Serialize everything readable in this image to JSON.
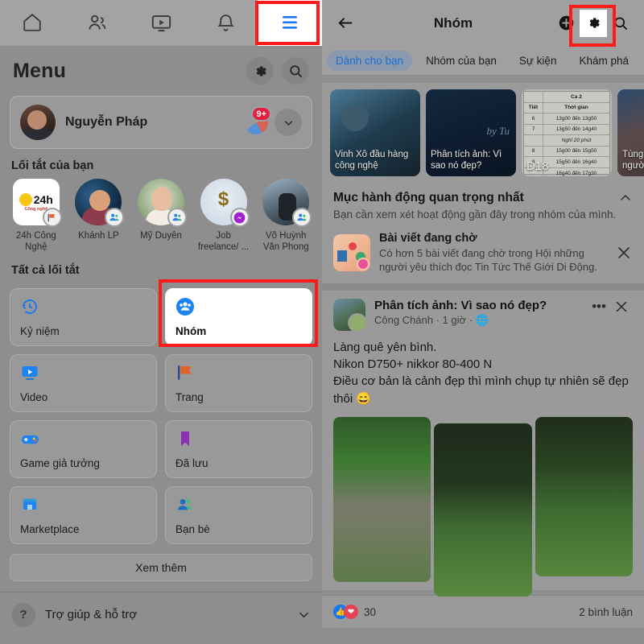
{
  "left": {
    "topnav": [
      {
        "name": "home",
        "icon": "home-icon"
      },
      {
        "name": "friends",
        "icon": "friends-icon"
      },
      {
        "name": "watch",
        "icon": "video-icon"
      },
      {
        "name": "notifications",
        "icon": "bell-icon"
      },
      {
        "name": "menu",
        "icon": "hamburger-icon",
        "active": true
      }
    ],
    "menu_title": "Menu",
    "gear_label": "gear-icon",
    "search_label": "search-icon",
    "profile": {
      "name": "Nguyễn Pháp",
      "badge": "9+"
    },
    "shortcuts_label": "Lối tắt của bạn",
    "shortcuts": [
      {
        "label": "24h Công Nghệ",
        "badge": "page"
      },
      {
        "label": "Khánh LP",
        "badge": "group"
      },
      {
        "label": "Mỹ Duyên",
        "badge": "group"
      },
      {
        "label": "Job freelance/ ...",
        "badge": "messenger"
      },
      {
        "label": "Võ Huỳnh Văn Phong",
        "badge": "group"
      }
    ],
    "all_shortcuts_label": "Tất cả lối tắt",
    "tiles": [
      {
        "label": "Kỷ niệm",
        "icon": "clock-history-icon",
        "highlight": false
      },
      {
        "label": "Nhóm",
        "icon": "groups-icon",
        "highlight": true
      },
      {
        "label": "Video",
        "icon": "video-icon",
        "highlight": false
      },
      {
        "label": "Trang",
        "icon": "flag-icon",
        "highlight": false
      },
      {
        "label": "Game giả tưởng",
        "icon": "gamepad-icon",
        "highlight": false
      },
      {
        "label": "Đã lưu",
        "icon": "bookmark-icon",
        "highlight": false
      },
      {
        "label": "Marketplace",
        "icon": "store-icon",
        "highlight": false
      },
      {
        "label": "Bạn bè",
        "icon": "friends-icon",
        "highlight": false
      }
    ],
    "see_more": "Xem thêm",
    "help": {
      "label": "Trợ giúp & hỗ trợ",
      "icon": "question-icon",
      "chevron": "chevron-down-icon"
    }
  },
  "right": {
    "header": {
      "back": "back-arrow-icon",
      "title": "Nhóm",
      "add": "plus-circle-icon",
      "settings": "gear-icon",
      "search": "search-icon"
    },
    "tabs": [
      {
        "label": "Dành cho bạn",
        "active": true
      },
      {
        "label": "Nhóm của bạn",
        "active": false
      },
      {
        "label": "Sự kiện",
        "active": false
      },
      {
        "label": "Khám phá",
        "active": false
      }
    ],
    "stories": [
      {
        "caption": "Vinh Xô đầu hàng công nghệ",
        "style": "st1"
      },
      {
        "caption": "Phân tích ảnh: Vì sao nó đẹp?",
        "style": "st2"
      },
      {
        "caption": "",
        "style": "st3",
        "overlay": "D18"
      },
      {
        "caption": "Tùng và n\nngười bạn",
        "style": "st4"
      }
    ],
    "story_table": {
      "header": "Ca 2",
      "columns": [
        "Tiết",
        "Thời gian"
      ],
      "rows": [
        [
          "6",
          "13g00 đến 13g50"
        ],
        [
          "7",
          "13g50 đến 14g40"
        ],
        [
          "",
          "Nghỉ 20 phút"
        ],
        [
          "8",
          "15g00 đến 15g50"
        ],
        [
          "9",
          "15g50 đến 16g40"
        ],
        [
          "",
          "16g40 đến 17g30"
        ]
      ]
    },
    "action_block": {
      "title": "Mục hành động quan trọng nhất",
      "subtitle": "Bạn cần xem xét hoạt động gần đây trong nhóm của mình.",
      "collapse_icon": "chevron-up-icon",
      "pending": {
        "title": "Bài viết đang chờ",
        "desc": "Có hơn 5 bài viết đang chờ trong Hội những người yêu thích đọc Tin Tức Thế Giới Di Động.",
        "close_icon": "close-icon"
      }
    },
    "post": {
      "group_name": "Phân tích ảnh: Vì sao nó đẹp?",
      "author": "Công Chánh",
      "time": "1 giờ",
      "privacy_icon": "public-icon",
      "menu_icon": "more-options-icon",
      "close_icon": "close-icon",
      "body": "Làng quê yên bình.\nNikon D750+ nikkor 80-400 N\nĐiều cơ bản là cảnh đẹp thì mình chụp tự nhiên sẽ đẹp thôi 😄",
      "reactions": "30",
      "comments": "2 bình luận"
    }
  },
  "annotations": {
    "highlight_color": "#ff1a1a",
    "boxes": [
      "menu-tab",
      "groups-tile",
      "group-settings-gear"
    ]
  }
}
